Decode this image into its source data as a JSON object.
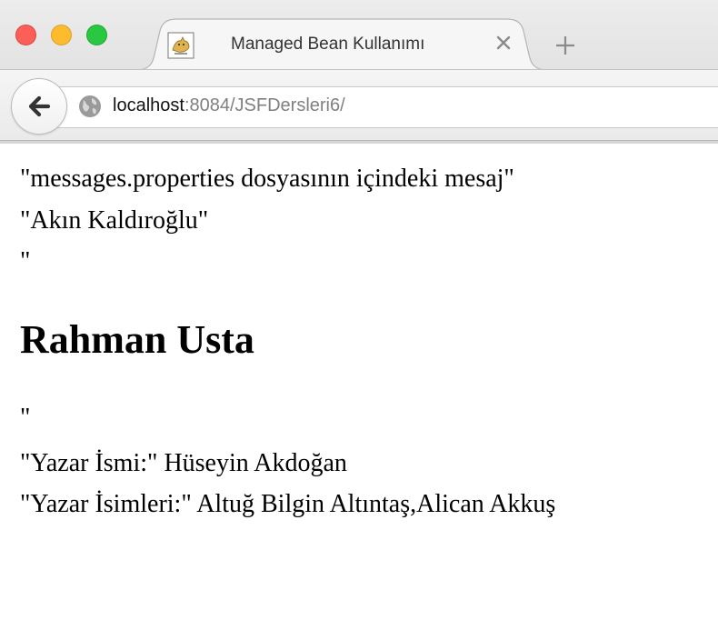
{
  "browser": {
    "tab": {
      "title": "Managed Bean Kullanımı",
      "favicon": "tomcat-icon"
    },
    "address": {
      "host": "localhost",
      "path": ":8084/JSFDersleri6/"
    }
  },
  "page": {
    "line1": "\"messages.properties dosyasının içindeki mesaj\"",
    "line2": "\"Akın Kaldıroğlu\"",
    "line3": "\"",
    "heading": "Rahman Usta",
    "line4": "\"",
    "line5": "\"Yazar İsmi:\" Hüseyin Akdoğan",
    "line6": "\"Yazar İsimleri:\" Altuğ Bilgin Altıntaş,Alican Akkuş"
  }
}
